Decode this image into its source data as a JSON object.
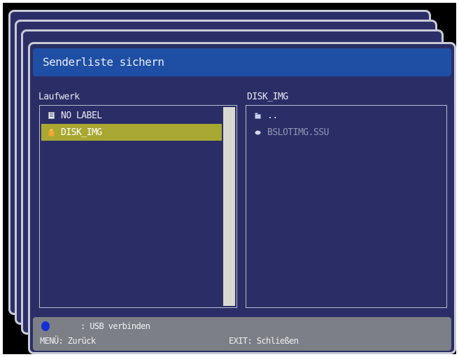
{
  "dialog": {
    "title": "Senderliste sichern"
  },
  "left_pane": {
    "label": "Laufwerk",
    "items": [
      {
        "label": "NO LABEL",
        "icon": "drive-icon",
        "selected": false
      },
      {
        "label": "DISK_IMG",
        "icon": "usb-drive-icon",
        "selected": true
      }
    ]
  },
  "right_pane": {
    "label": "DISK_IMG",
    "items": [
      {
        "label": "..",
        "icon": "folder-up-icon"
      },
      {
        "label": "BSLOTIMG.SSU",
        "icon": "file-icon"
      }
    ]
  },
  "bottom_bar": {
    "usb_hint": ": USB verbinden",
    "back_hint": "MENÜ: Zurück",
    "exit_hint": "EXIT: Schließen"
  },
  "colors": {
    "background": "#2b2e66",
    "title_bar": "#1f4fa4",
    "selection": "#a8a832",
    "bottom_bar": "#7d7f86",
    "blue_button": "#1531d6"
  }
}
